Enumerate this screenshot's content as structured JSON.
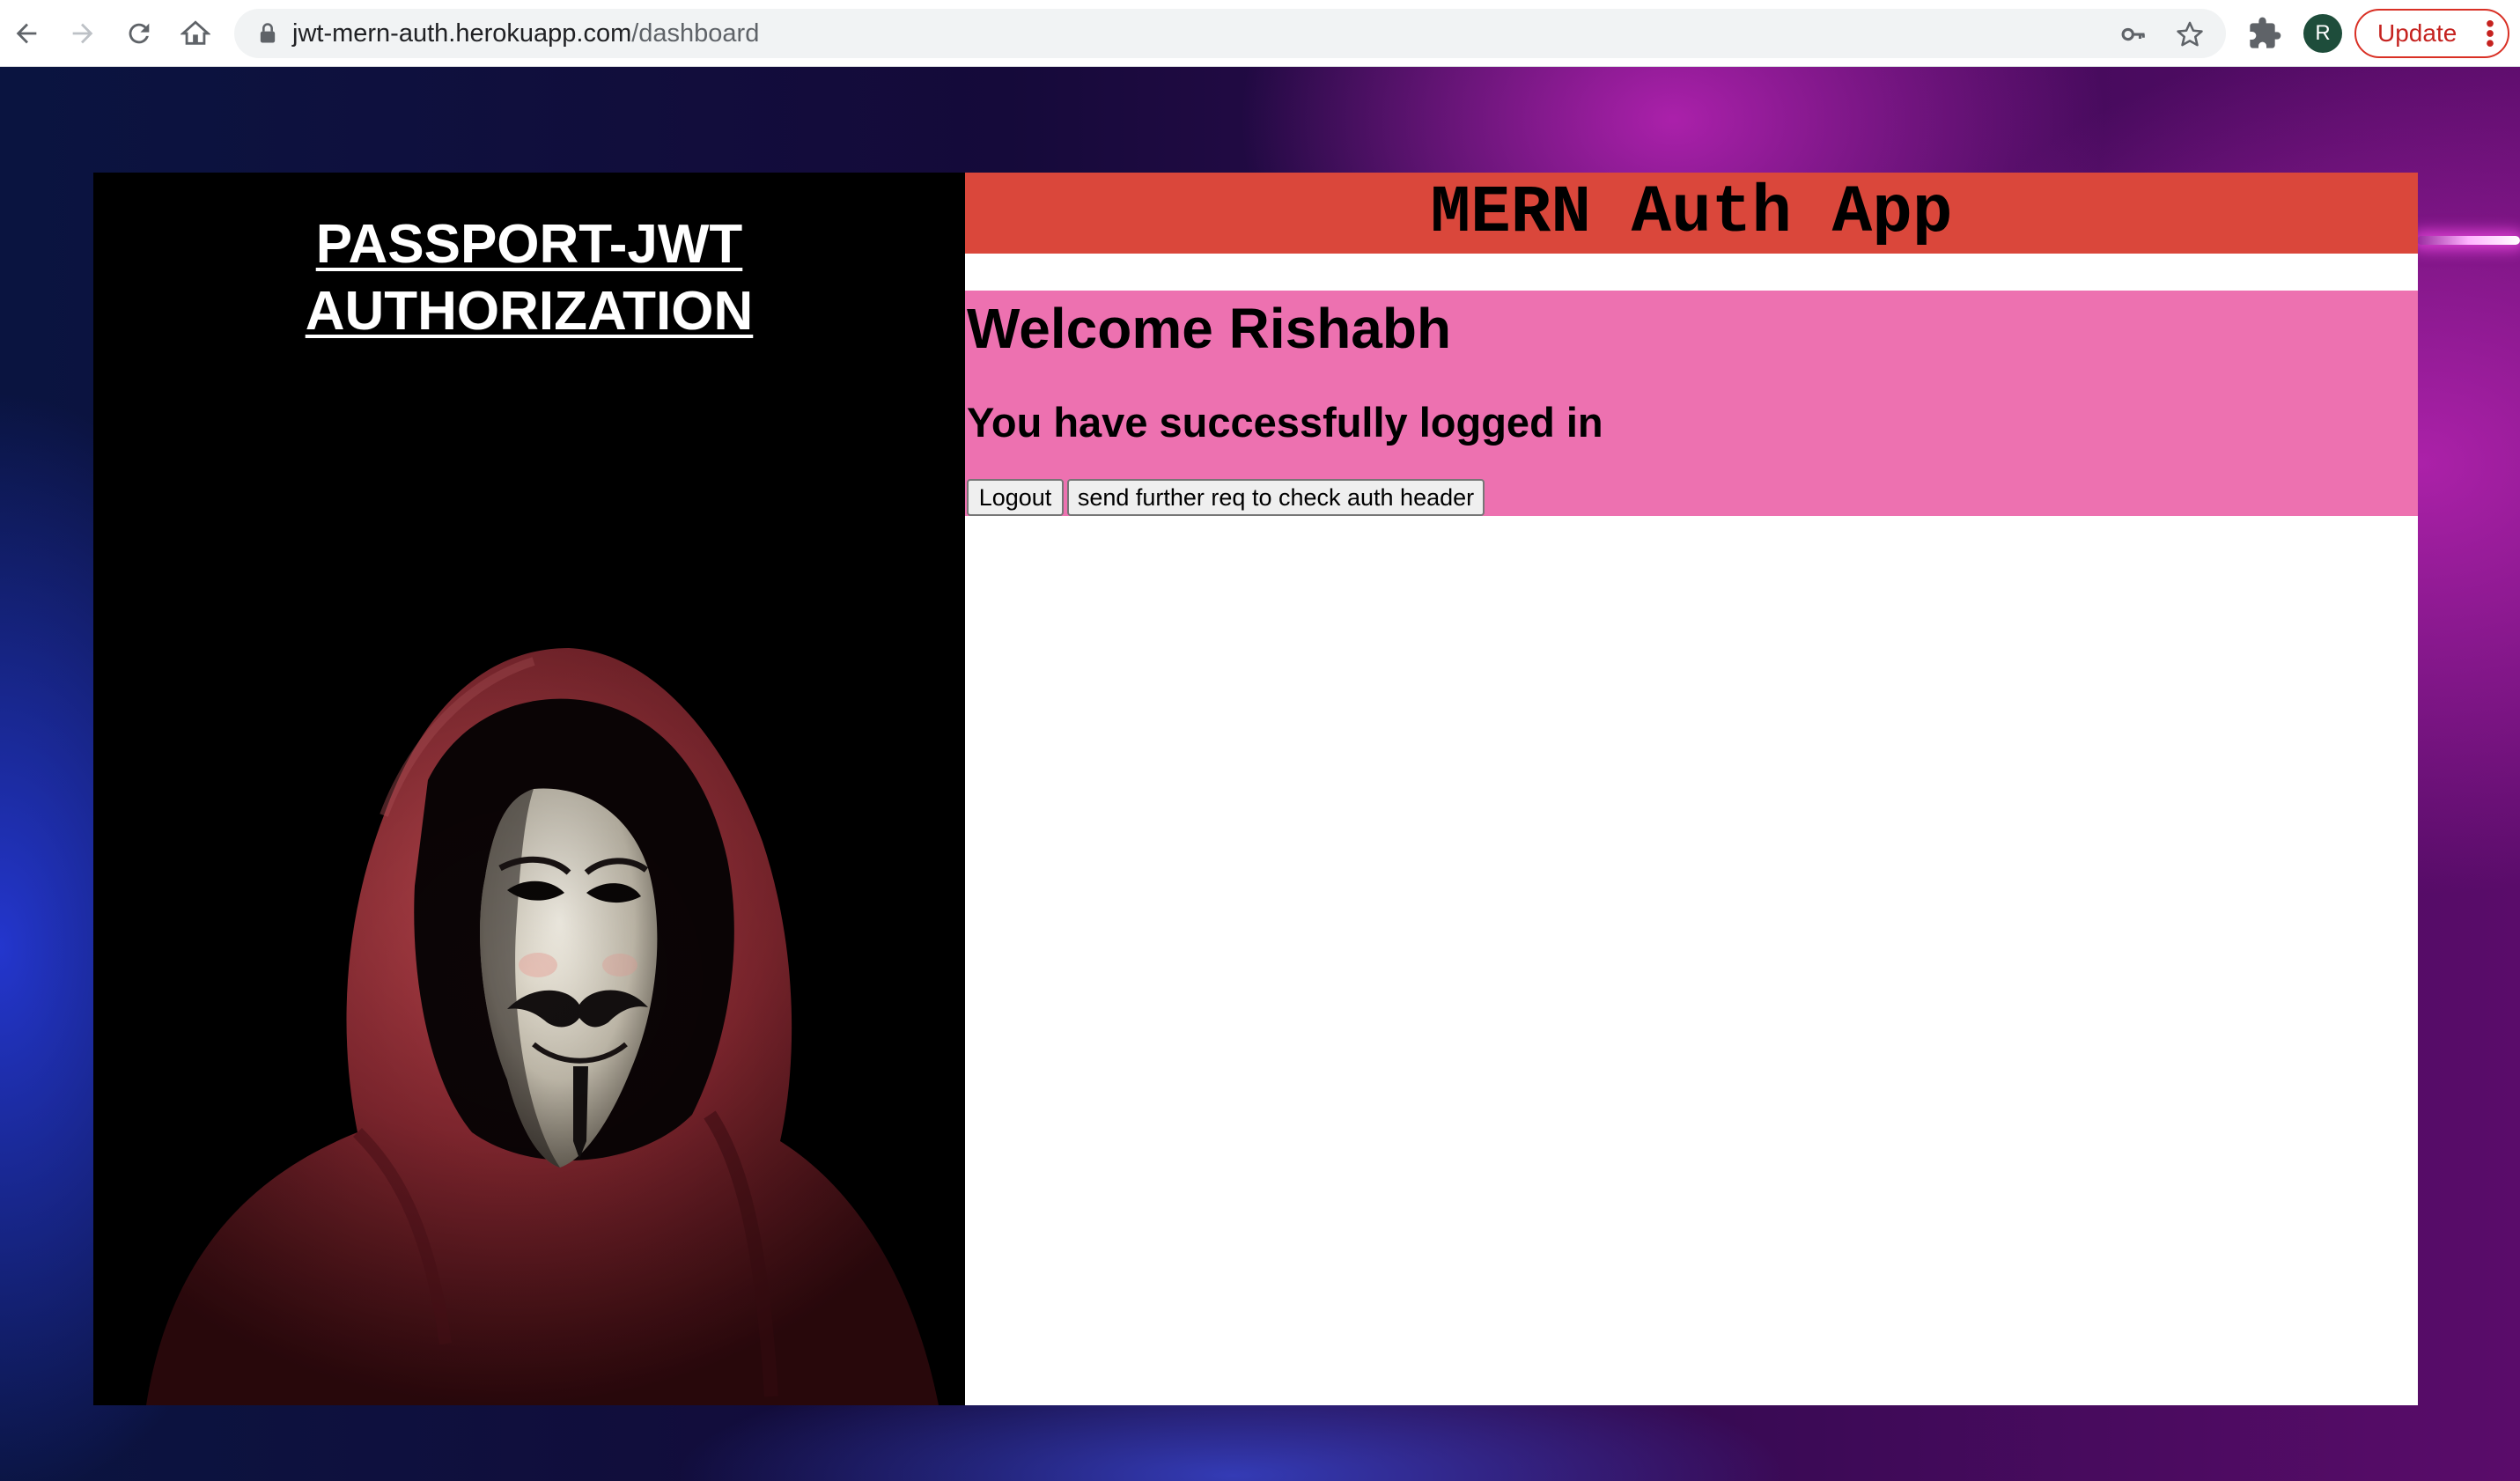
{
  "browser": {
    "url_domain": "jwt-mern-auth.herokuapp.com",
    "url_path": "/dashboard",
    "avatar_initial": "R",
    "update_label": "Update",
    "icons": [
      "back-arrow-icon",
      "forward-arrow-icon",
      "reload-icon",
      "home-icon",
      "lock-icon",
      "key-icon",
      "star-icon",
      "puzzle-icon",
      "kebab-menu-icon"
    ]
  },
  "left_panel": {
    "title_line1": "PASSPORT-JWT",
    "title_line2": "AUTHORIZATION"
  },
  "app": {
    "title": "MERN Auth App",
    "welcome": "Welcome Rishabh",
    "success_message": "You have successfully logged in",
    "logout_label": "Logout",
    "send_req_label": "send further req to check auth header"
  },
  "colors": {
    "header_red": "#da473b",
    "welcome_pink": "#ed71b0",
    "chrome_update_red": "#c5221f"
  }
}
